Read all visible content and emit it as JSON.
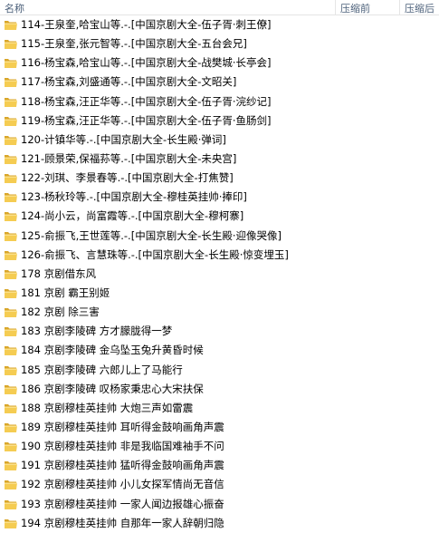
{
  "header": {
    "name": "名称",
    "compressed_before": "压缩前",
    "compressed_after": "压缩后"
  },
  "folder_icon": "folder-icon",
  "files": [
    "114-王泉奎,哈宝山等.-.[中国京剧大全-伍子胥·刺王僚]",
    "115-王泉奎,张元智等.-.[中国京剧大全-五台会兄]",
    "116-杨宝森,哈宝山等.-.[中国京剧大全-战樊城·长亭会]",
    "117-杨宝森,刘盛通等.-.[中国京剧大全-文昭关]",
    "118-杨宝森,汪正华等.-.[中国京剧大全-伍子胥·浣纱记]",
    "119-杨宝森,汪正华等.-.[中国京剧大全-伍子胥·鱼肠剑]",
    "120-计镇华等.-.[中国京剧大全-长生殿·弹词]",
    "121-顾景荣,保福荪等.-.[中国京剧大全-未央宫]",
    "122-刘琪、李景春等.-.[中国京剧大全-打焦赞]",
    "123-杨秋玲等.-.[中国京剧大全-穆桂英挂帅·捧印]",
    "124-尚小云，尚富霞等.-.[中国京剧大全-穆柯寨]",
    "125-俞振飞,王世莲等.-.[中国京剧大全-长生殿·迎像哭像]",
    "126-俞振飞、言慧珠等.-.[中国京剧大全-长生殿·惊变埋玉]",
    "178 京剧借东风",
    "181 京剧  霸王别姬",
    "182 京剧  除三害",
    "183 京剧李陵碑  方才朦胧得一梦",
    "184 京剧李陵碑  金乌坠玉兔升黄昏时候",
    "185 京剧李陵碑  六郎儿上了马能行",
    "186 京剧李陵碑  叹杨家秉忠心大宋扶保",
    "188 京剧穆桂英挂帅  大炮三声如雷震",
    "189 京剧穆桂英挂帅  耳听得金鼓响画角声震",
    "190 京剧穆桂英挂帅  非是我临国难袖手不问",
    "191 京剧穆桂英挂帅  猛听得金鼓响画角声震",
    "192 京剧穆桂英挂帅  小儿女探军情尚无音信",
    "193 京剧穆桂英挂帅  一家人闻边报雄心振奋",
    "194 京剧穆桂英挂帅  自那年一家人辞朝归隐"
  ]
}
